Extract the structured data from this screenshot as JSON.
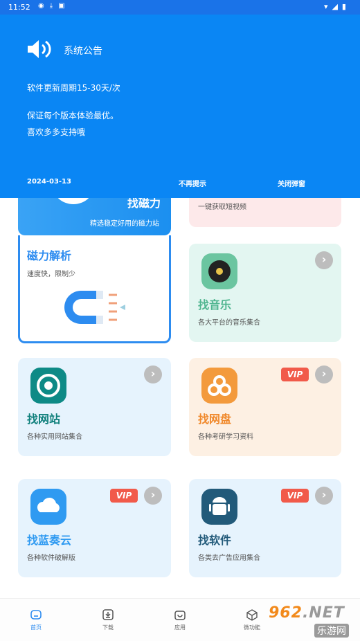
{
  "status_bar": {
    "time": "11:52"
  },
  "notice": {
    "title": "系统公告",
    "lines": [
      "软件更新周期15-30天/次",
      "保证每个版本体验最优。",
      "喜欢多多支持哦"
    ],
    "date": "2024-03-13",
    "no_remind_label": "不再提示",
    "close_label": "关闭弹窗"
  },
  "cards": {
    "magnet_top": {
      "title": "找磁力",
      "desc": "精选稳定好用的磁力站"
    },
    "magnet_parse": {
      "title": "磁力解析",
      "desc": "速度快，限制少"
    },
    "video_top": {
      "desc": "一键获取短视频"
    },
    "music": {
      "title": "找音乐",
      "desc": "各大平台的音乐集合"
    },
    "website": {
      "title": "找网站",
      "desc": "各种实用网站集合"
    },
    "netdisk": {
      "title": "找网盘",
      "desc": "各种考研学习资料",
      "badge": "VIP"
    },
    "lanzou": {
      "title": "找蓝奏云",
      "desc": "各种软件破解版",
      "badge": "VIP"
    },
    "software": {
      "title": "找软件",
      "desc": "各类去广告应用集合",
      "badge": "VIP"
    }
  },
  "bottom_nav": [
    {
      "label": "首页",
      "icon": "home-icon"
    },
    {
      "label": "下载",
      "icon": "download-icon"
    },
    {
      "label": "应用",
      "icon": "bag-icon"
    },
    {
      "label": "微功能",
      "icon": "cube-icon"
    }
  ],
  "watermark": {
    "text": "962.NET",
    "sub": "乐游网"
  },
  "colors": {
    "primary": "#0a86f4",
    "card_blue": "#e6f3fd",
    "card_green": "#e3f6f1",
    "card_orange": "#fdf0e3",
    "card_pink": "#fde9ea"
  }
}
